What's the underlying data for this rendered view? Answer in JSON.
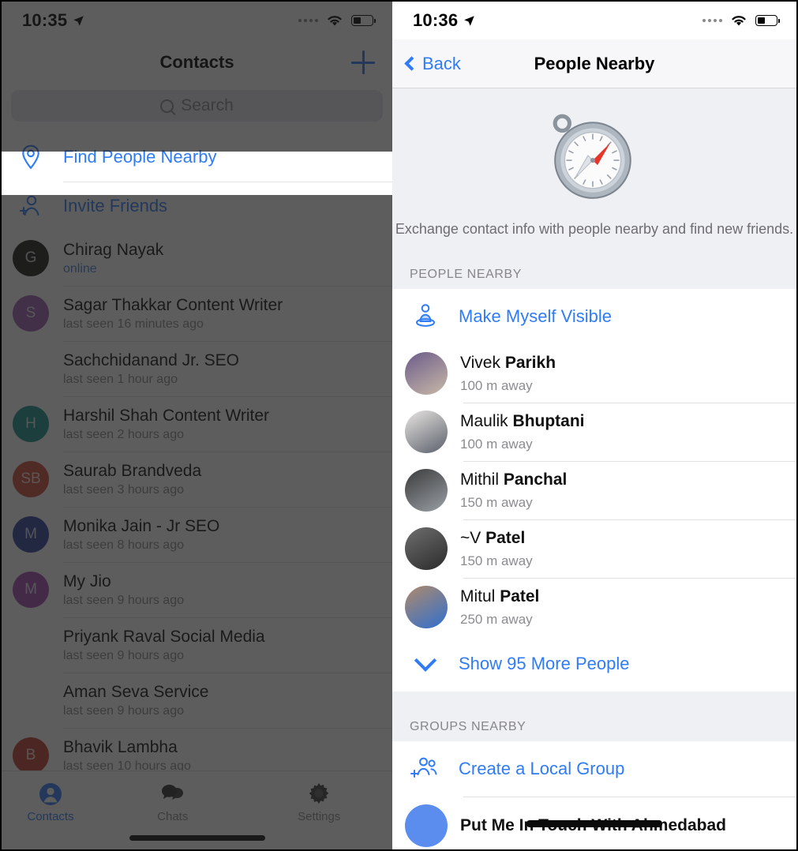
{
  "left": {
    "status": {
      "time": "10:35",
      "location_icon": "location-arrow-icon",
      "wifi_icon": "wifi-icon",
      "battery_icon": "battery-icon"
    },
    "nav": {
      "title": "Contacts",
      "add_icon": "plus-icon"
    },
    "search": {
      "placeholder": "Search",
      "icon": "search-icon"
    },
    "highlight": {
      "label": "Find People Nearby",
      "icon": "location-pin-icon"
    },
    "invite": {
      "label": "Invite Friends",
      "icon": "person-add-icon"
    },
    "contacts": [
      {
        "name": "Chirag Nayak",
        "status": "online",
        "online": true,
        "initials": "G",
        "color": "#1c1a17"
      },
      {
        "name": "Sagar Thakkar Content Writer",
        "status": "last seen 16 minutes ago",
        "online": false,
        "initials": "S",
        "color": "#9a5fb0"
      },
      {
        "name": "Sachchidanand Jr. SEO",
        "status": "last seen 1 hour ago",
        "online": false,
        "initials": "",
        "color": ""
      },
      {
        "name": "Harshil Shah Content Writer",
        "status": "last seen 2 hours ago",
        "online": false,
        "initials": "H",
        "color": "#189089"
      },
      {
        "name": "Saurab Brandveda",
        "status": "last seen 3 hours ago",
        "online": false,
        "initials": "SB",
        "color": "#cf4b3c"
      },
      {
        "name": "Monika Jain - Jr SEO",
        "status": "last seen 8 hours ago",
        "online": false,
        "initials": "M",
        "color": "#2e3f9e"
      },
      {
        "name": "My Jio",
        "status": "last seen 9 hours ago",
        "online": false,
        "initials": "M",
        "color": "#a14cb0"
      },
      {
        "name": "Priyank Raval Social Media",
        "status": "last seen 9 hours ago",
        "online": false,
        "initials": "",
        "color": ""
      },
      {
        "name": "Aman Seva Service",
        "status": "last seen 9 hours ago",
        "online": false,
        "initials": "",
        "color": ""
      },
      {
        "name": "Bhavik Lambha",
        "status": "last seen 10 hours ago",
        "online": false,
        "initials": "B",
        "color": "#c0392b"
      }
    ],
    "tabs": [
      {
        "label": "Contacts",
        "icon": "person-circle-icon",
        "active": true
      },
      {
        "label": "Chats",
        "icon": "chat-bubbles-icon",
        "active": false
      },
      {
        "label": "Settings",
        "icon": "gear-icon",
        "active": false
      }
    ]
  },
  "right": {
    "status": {
      "time": "10:36",
      "location_icon": "location-arrow-icon",
      "wifi_icon": "wifi-icon",
      "battery_icon": "battery-icon"
    },
    "nav": {
      "back_label": "Back",
      "back_icon": "chevron-left-icon",
      "title": "People Nearby"
    },
    "hero": {
      "icon": "compass-icon",
      "description": "Exchange contact info with people nearby and find new friends."
    },
    "people_section": {
      "header": "PEOPLE NEARBY",
      "visible_action": {
        "label": "Make Myself Visible",
        "icon": "person-visible-icon"
      },
      "people": [
        {
          "first": "Vivek",
          "last": "Parikh",
          "distance": "100 m away",
          "avatar": "photo-vivek"
        },
        {
          "first": "Maulik",
          "last": "Bhuptani",
          "distance": "100 m away",
          "avatar": "photo-maulik"
        },
        {
          "first": "Mithil",
          "last": "Panchal",
          "distance": "150 m away",
          "avatar": "photo-mithil"
        },
        {
          "first": "~V",
          "last": "Patel",
          "distance": "150 m away",
          "avatar": "photo-v"
        },
        {
          "first": "Mitul",
          "last": "Patel",
          "distance": "250 m away",
          "avatar": "photo-mitul"
        }
      ],
      "show_more": {
        "label": "Show 95 More People",
        "icon": "chevron-down-icon"
      }
    },
    "groups_section": {
      "header": "GROUPS NEARBY",
      "create_action": {
        "label": "Create a Local Group",
        "icon": "people-add-icon"
      },
      "groups": [
        {
          "name": "Put Me In Touch With Ahmedabad",
          "color": "#5b8def"
        }
      ]
    }
  },
  "colors": {
    "accent": "#2f7cf6",
    "dim_overlay": "rgba(30,30,30,0.72)",
    "panel_bg": "#eff0f4"
  }
}
